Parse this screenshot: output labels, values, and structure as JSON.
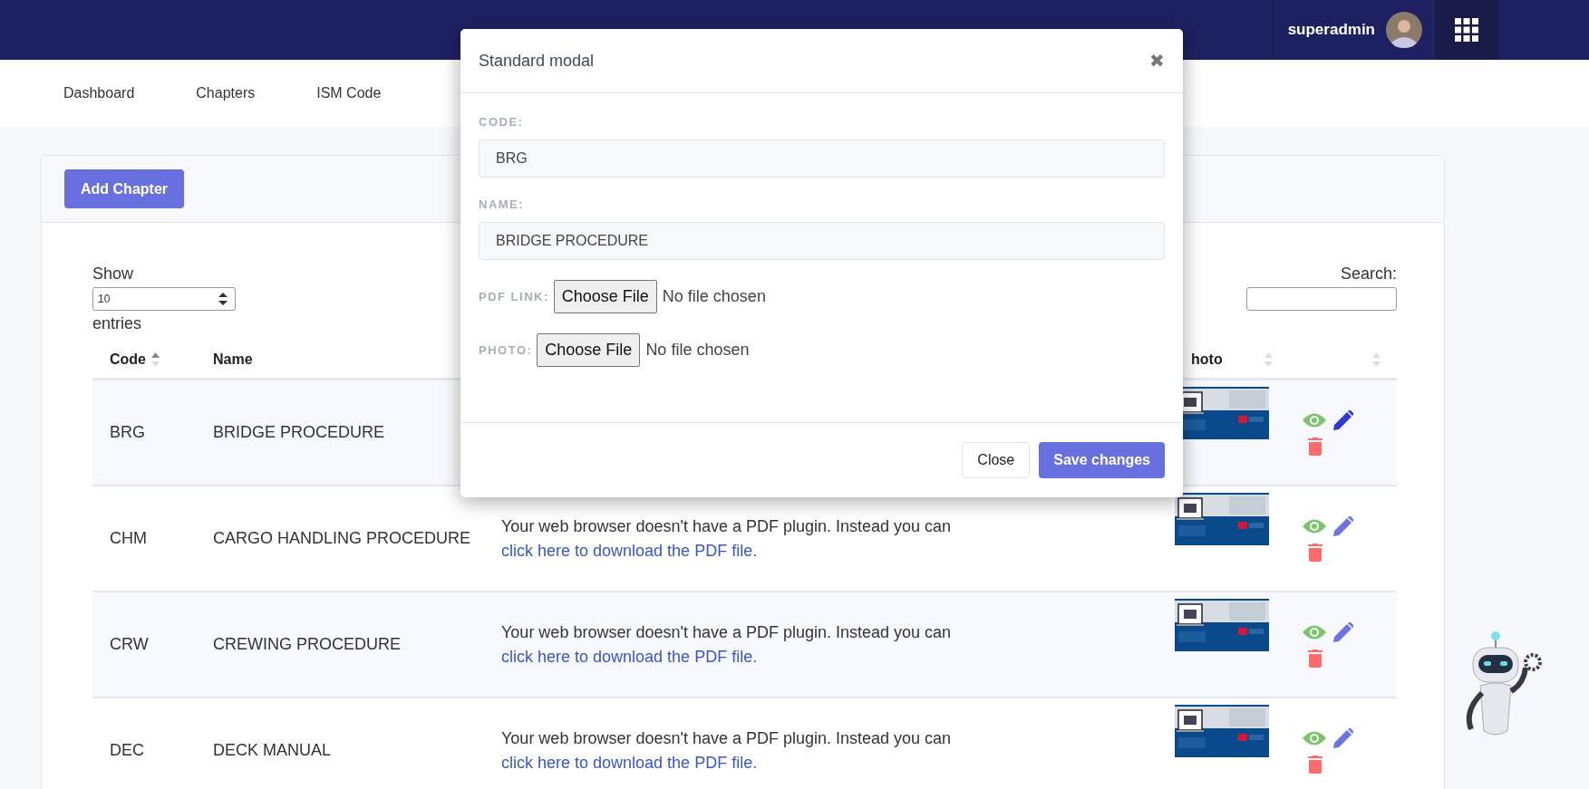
{
  "navbar": {
    "username": "superadmin"
  },
  "nav": [
    {
      "label": "Dashboard"
    },
    {
      "label": "Chapters"
    },
    {
      "label": "ISM Code"
    }
  ],
  "toolbar": {
    "add_button": "Add Chapter"
  },
  "length": {
    "label_before": "Show",
    "value": "10",
    "label_after": "entries"
  },
  "search": {
    "label": "Search:"
  },
  "table": {
    "columns": [
      {
        "label": "Code",
        "sortable": true,
        "sorted": true
      },
      {
        "label": "Name"
      },
      {
        "label": "hoto",
        "sortable": true,
        "sorted": false
      },
      {
        "sortable": true,
        "sorted": false
      }
    ],
    "rows": [
      {
        "code": "BRG",
        "name": "BRIDGE PROCEDURE",
        "edit_hover": true
      },
      {
        "code": "CHM",
        "name": "CARGO HANDLING PROCEDURE",
        "pdf_text": "Your web browser doesn't have a PDF plugin. Instead you can",
        "pdf_link": "click here to download the PDF file.",
        "edit_hover": false
      },
      {
        "code": "CRW",
        "name": "CREWING PROCEDURE",
        "pdf_text": "Your web browser doesn't have a PDF plugin. Instead you can",
        "pdf_link": "click here to download the PDF file.",
        "edit_hover": false
      },
      {
        "code": "DEC",
        "name": "DECK MANUAL",
        "pdf_text": "Your web browser doesn't have a PDF plugin. Instead you can",
        "pdf_link": "click here to download the PDF file.",
        "edit_hover": false
      }
    ]
  },
  "modal": {
    "title": "Standard modal",
    "close": "✖",
    "fields": [
      {
        "kind": "text",
        "label": "CODE:",
        "value": "BRG"
      },
      {
        "kind": "text",
        "label": "NAME:",
        "value": "BRIDGE PROCEDURE"
      },
      {
        "kind": "file",
        "label": "PDF LINK:",
        "button": "Choose File",
        "status": "No file chosen"
      },
      {
        "kind": "file",
        "label": "PHOTO:",
        "button": "Choose File",
        "status": "No file chosen"
      }
    ],
    "buttons": [
      {
        "kind": "secondary",
        "label": "Close"
      },
      {
        "kind": "primary",
        "label": "Save changes"
      }
    ]
  }
}
